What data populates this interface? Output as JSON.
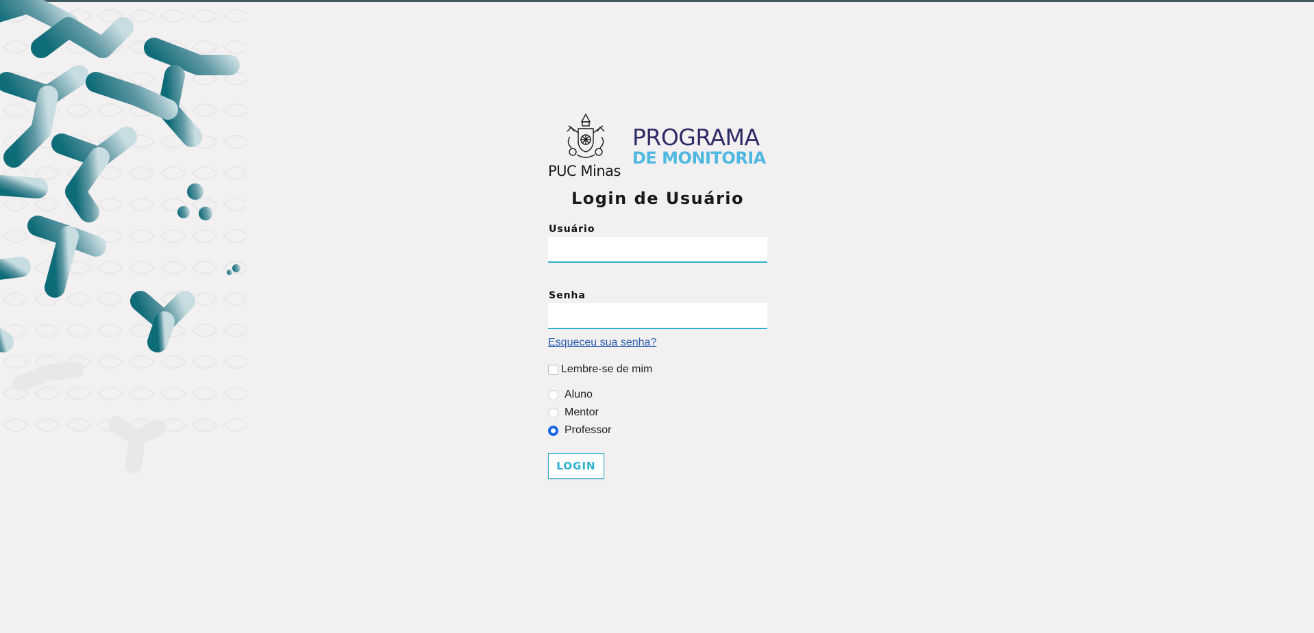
{
  "branding": {
    "institution": "PUC Minas",
    "program_line1": "PROGRAMA",
    "program_line2": "DE MONITORIA"
  },
  "form": {
    "title": "Login de Usuário",
    "username_label": "Usuário",
    "username_value": "",
    "password_label": "Senha",
    "password_value": "",
    "forgot_link": "Esqueceu sua senha?",
    "remember_label": "Lembre-se de mim",
    "remember_checked": false,
    "roles": [
      {
        "label": "Aluno",
        "checked": false
      },
      {
        "label": "Mentor",
        "checked": false
      },
      {
        "label": "Professor",
        "checked": true
      }
    ],
    "submit_label": "LOGIN"
  },
  "colors": {
    "accent": "#2bb0cf",
    "background": "#f2f0f1",
    "decor_teal": "#0e6b78",
    "link": "#2a5db0",
    "radio_selected": "#1a66e6",
    "program_dark": "#2e2b66",
    "program_light": "#4fb8e0"
  }
}
